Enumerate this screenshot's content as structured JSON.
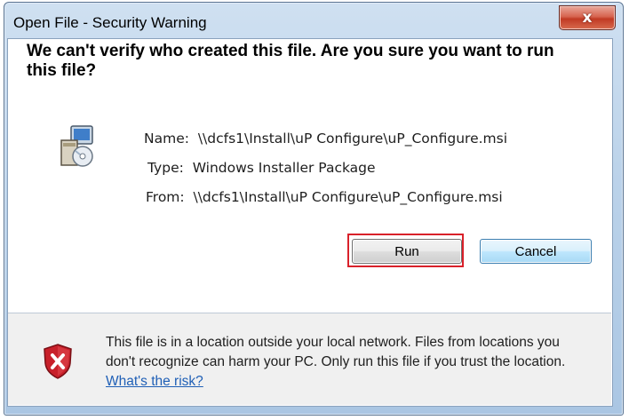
{
  "window": {
    "title": "Open File - Security Warning",
    "close_glyph": "x"
  },
  "headline": "We can't verify who created this file. Are you sure you want to run this file?",
  "info": {
    "name_label": "Name:",
    "name_value": "\\\\dcfs1\\Install\\uP Configure\\uP_Configure.msi",
    "type_label": "Type:",
    "type_value": "Windows Installer Package",
    "from_label": "From:",
    "from_value": "\\\\dcfs1\\Install\\uP Configure\\uP_Configure.msi"
  },
  "buttons": {
    "run": "Run",
    "cancel": "Cancel"
  },
  "footer": {
    "text": "This file is in a location outside your local network. Files from locations you don't recognize can harm your PC. Only run this file if you trust the location.",
    "link": "What's the risk?"
  },
  "icons": {
    "installer": "installer-package-icon",
    "shield": "security-shield-icon",
    "close": "close-icon"
  },
  "colors": {
    "highlight": "#d9212a",
    "link": "#1f5fb6",
    "shield_red": "#c8202a"
  }
}
